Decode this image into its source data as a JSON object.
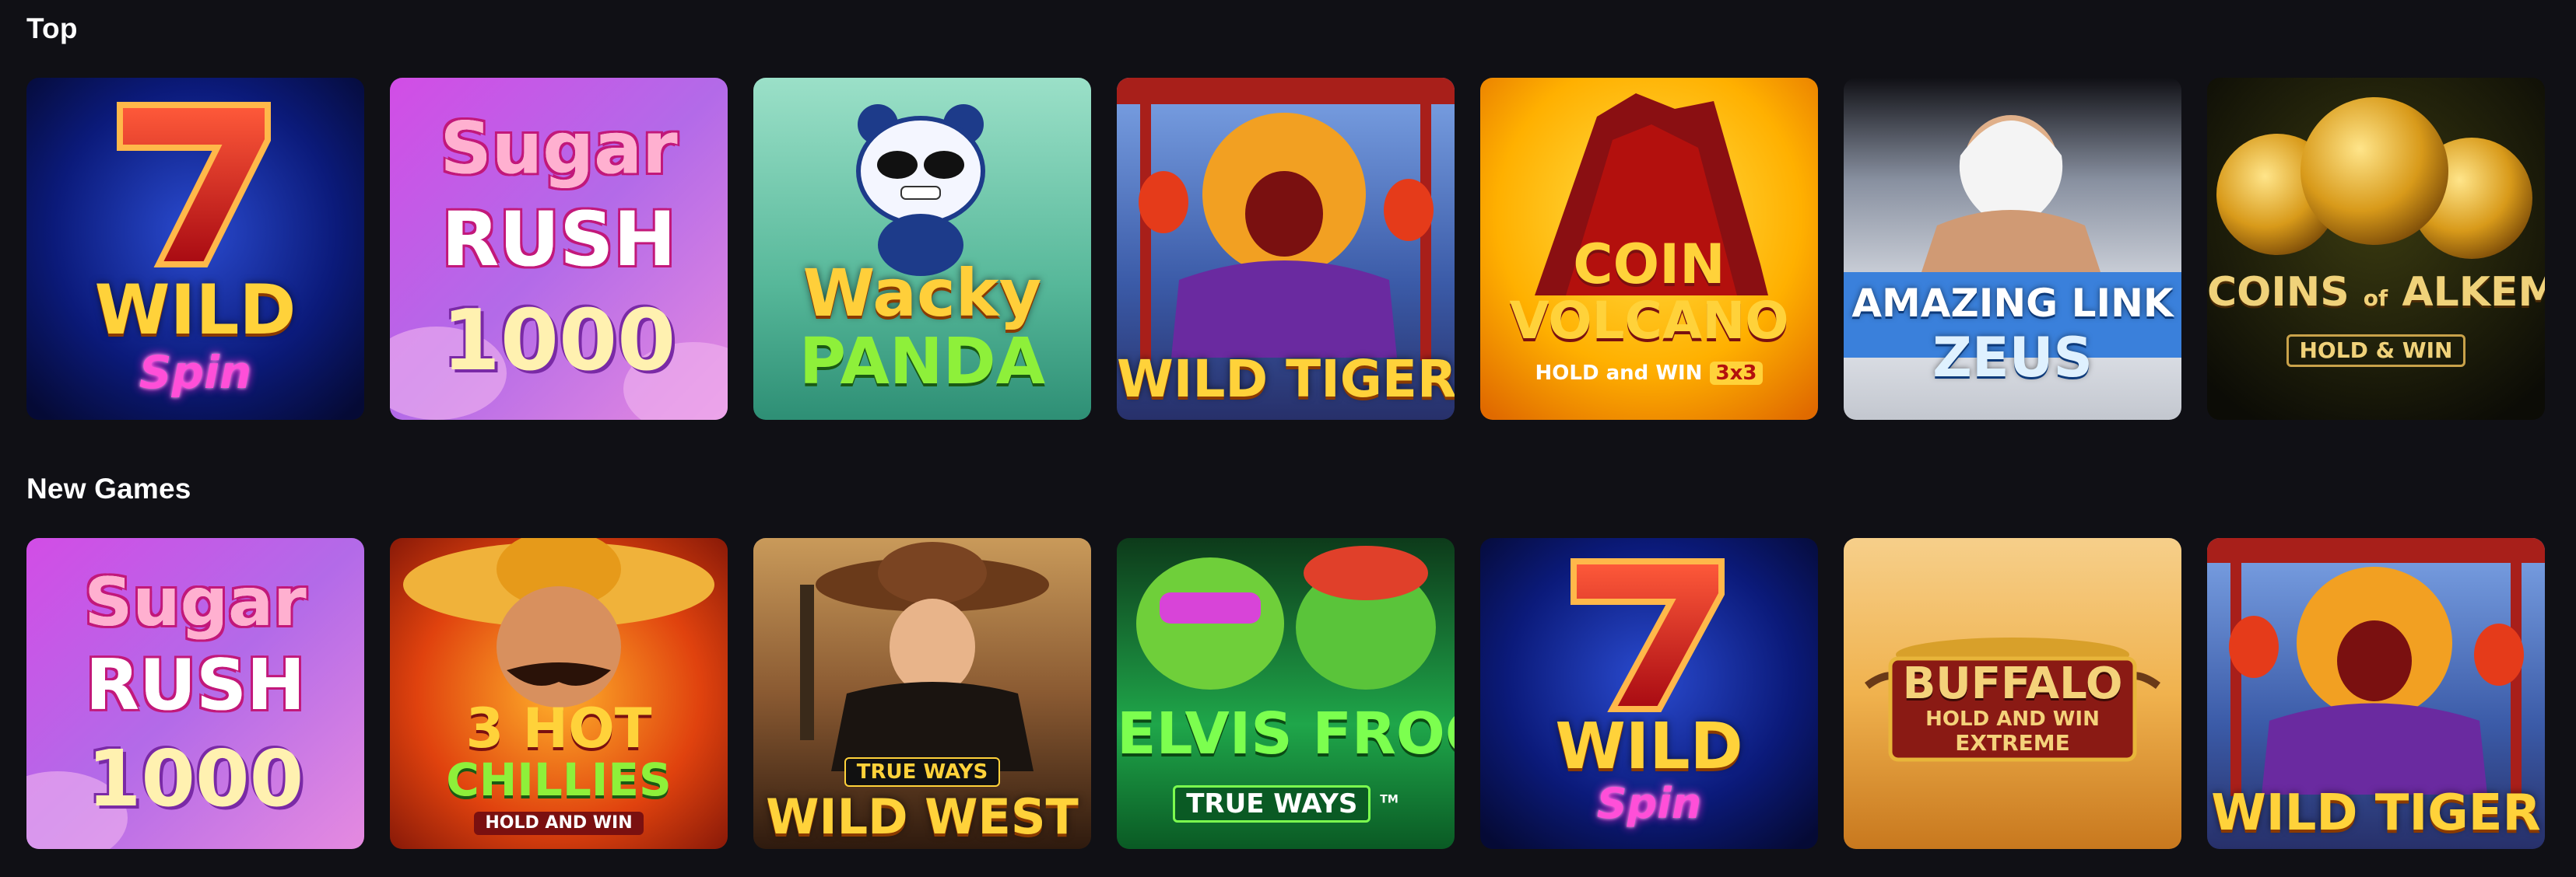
{
  "sections": {
    "top": {
      "title": "Top",
      "games": [
        {
          "name": "7 Wild Spin",
          "line1": "7",
          "line2": "WILD",
          "line3": "Spin",
          "icon": "seven-symbol",
          "colors": {
            "bg": "#0a1a6e",
            "accent": "#e01a1a"
          }
        },
        {
          "name": "Sugar Rush 1000",
          "line1": "Sugar",
          "line2": "RUSH",
          "line3": "1000",
          "icon": "candy-text",
          "colors": {
            "bg": "#c44ad9",
            "accent": "#ff7eb8"
          }
        },
        {
          "name": "Wacky Panda",
          "line1": "Wacky",
          "line2": "PANDA",
          "icon": "panda-character",
          "colors": {
            "bg": "#4fb59a",
            "accent": "#ffce2e"
          }
        },
        {
          "name": "Wild Tiger",
          "line1": "WILD TIGER",
          "icon": "tiger-character",
          "colors": {
            "bg": "#3b5ba8",
            "accent": "#ffd23a"
          }
        },
        {
          "name": "Coin Volcano",
          "line1": "COIN",
          "line2": "VOLCANO",
          "line3": "HOLD and WIN",
          "line3b": "3x3",
          "icon": "volcano",
          "colors": {
            "bg": "#ffb000",
            "accent": "#b3100d"
          }
        },
        {
          "name": "Amazing Link Zeus",
          "line1": "AMAZING LINK",
          "line2": "ZEUS",
          "icon": "zeus-character",
          "colors": {
            "bg": "#d9dde4",
            "accent": "#1f6fd6"
          }
        },
        {
          "name": "Coins of Alkemor",
          "line1": "COINS",
          "line1b": "of",
          "line1c": "ALKEMOR",
          "line2": "HOLD & WIN",
          "icon": "gold-coins",
          "colors": {
            "bg": "#141408",
            "accent": "#e8b53a"
          }
        }
      ]
    },
    "new_games": {
      "title": "New Games",
      "games": [
        {
          "name": "Sugar Rush 1000",
          "line1": "Sugar",
          "line2": "RUSH",
          "line3": "1000",
          "icon": "candy-text",
          "colors": {
            "bg": "#c44ad9",
            "accent": "#ff7eb8"
          }
        },
        {
          "name": "3 Hot Chillies",
          "line1": "3 HOT",
          "line2": "CHILLIES",
          "line3": "HOLD AND WIN",
          "icon": "mariachi-character",
          "colors": {
            "bg": "#d8300e",
            "accent": "#ffd23a"
          }
        },
        {
          "name": "Wild West True Ways",
          "line1": "TRUE WAYS",
          "line2": "WILD WEST",
          "icon": "cowgirl-character",
          "colors": {
            "bg": "#5a3a22",
            "accent": "#ffd23a"
          }
        },
        {
          "name": "Elvis Frog True Ways",
          "line1": "ELVIS FROG",
          "line2": "TRUE WAYS",
          "line2b": "TM",
          "icon": "frog-characters",
          "colors": {
            "bg": "#1fa64a",
            "accent": "#7cff4f"
          }
        },
        {
          "name": "7 Wild Spin",
          "line1": "7",
          "line2": "WILD",
          "line3": "Spin",
          "icon": "seven-symbol",
          "colors": {
            "bg": "#0a1a6e",
            "accent": "#e01a1a"
          }
        },
        {
          "name": "Buffalo Hold and Win Extreme",
          "line1": "BUFFALO",
          "line2": "HOLD AND WIN",
          "line3": "EXTREME",
          "icon": "buffalo-banner",
          "colors": {
            "bg": "#e8a24a",
            "accent": "#8a1a14"
          }
        },
        {
          "name": "Wild Tiger",
          "line1": "WILD TIGER",
          "icon": "tiger-character",
          "colors": {
            "bg": "#3b5ba8",
            "accent": "#ffd23a"
          }
        }
      ]
    }
  }
}
